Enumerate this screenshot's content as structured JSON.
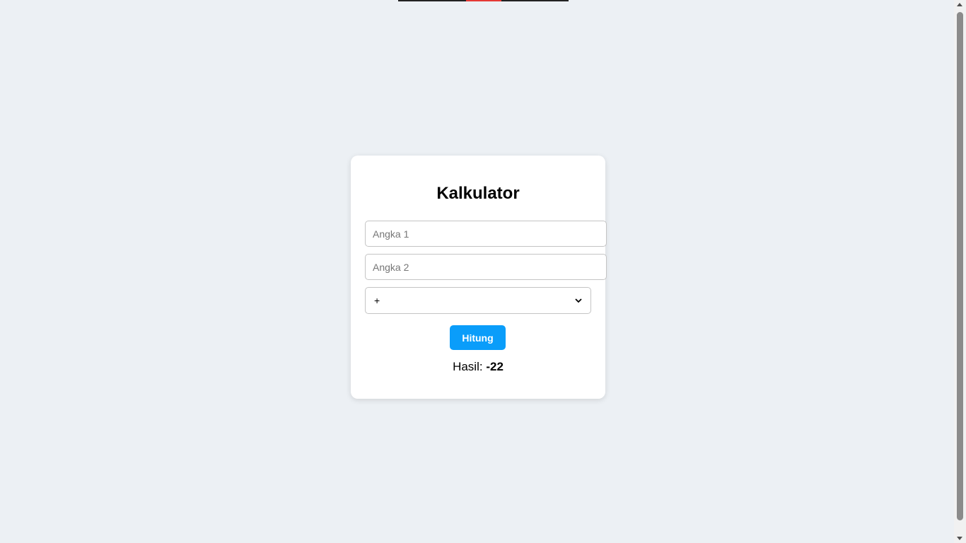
{
  "app": {
    "title": "Kalkulator"
  },
  "form": {
    "input1_placeholder": "Angka 1",
    "input1_value": "",
    "input2_placeholder": "Angka 2",
    "input2_value": "",
    "operator_selected": "+",
    "operator_options": [
      "+"
    ],
    "calc_button_label": "Hitung"
  },
  "result": {
    "label": "Hasil:",
    "value": "-22"
  },
  "icons": {
    "select_arrow": "chevron-down-icon",
    "scroll_up": "scroll-up-arrow-icon",
    "scroll_down": "scroll-down-arrow-icon"
  },
  "colors": {
    "background": "#ecf0f4",
    "card": "#ffffff",
    "button": "#0a9dfa",
    "button_text": "#ffffff"
  }
}
